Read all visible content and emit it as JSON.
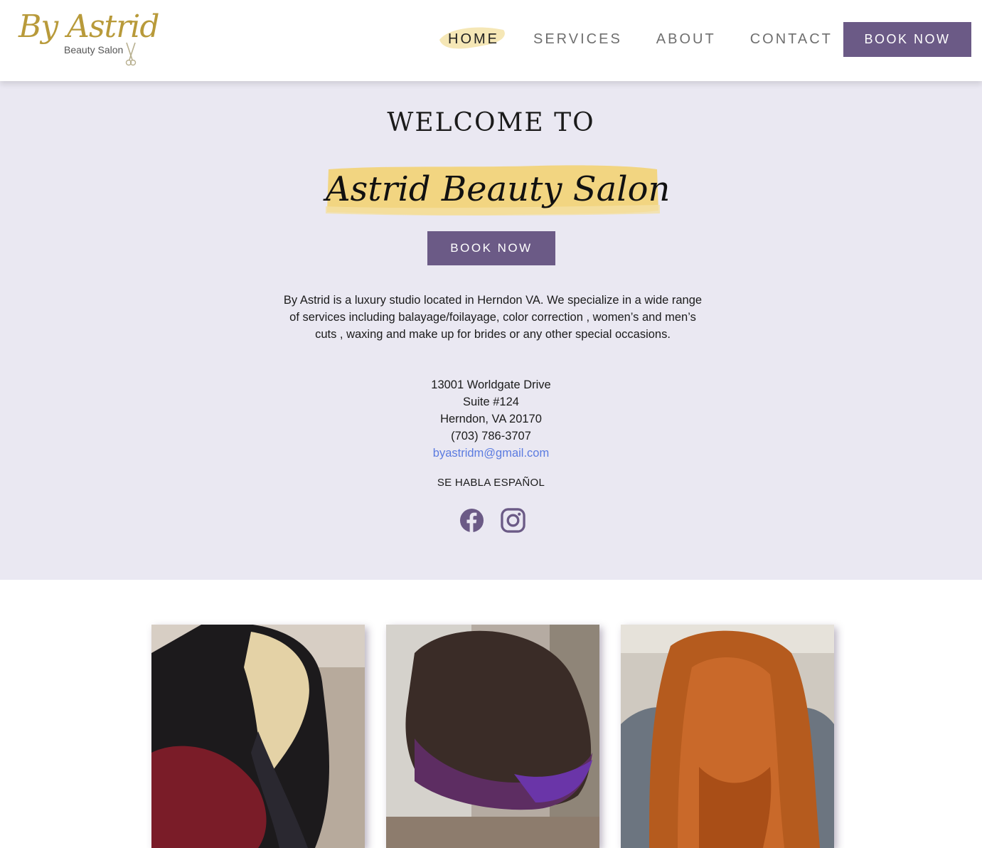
{
  "header": {
    "logo": {
      "script_text": "By Astrid",
      "subtitle": "Beauty Salon",
      "icon": "scissors-icon"
    },
    "nav": [
      {
        "label": "HOME",
        "active": true
      },
      {
        "label": "SERVICES",
        "active": false
      },
      {
        "label": "ABOUT",
        "active": false
      },
      {
        "label": "CONTACT",
        "active": false
      }
    ],
    "book_button": "BOOK NOW"
  },
  "hero": {
    "welcome": "WELCOME TO",
    "salon_name": "Astrid Beauty Salon",
    "book_button": "BOOK NOW",
    "description": "By Astrid is a luxury studio located in Herndon VA. We specialize in a wide range of services including balayage/foilayage, color correction , women’s and men’s cuts , waxing and make up for brides or any other special occasions.",
    "address_line1": "13001 Worldgate Drive",
    "address_line2": "Suite #124",
    "address_line3": "Herndon, VA 20170",
    "phone": "(703) 786-3707",
    "email": "byastridm@gmail.com",
    "language_note": "SE HABLA ESPAÑOL",
    "social": [
      {
        "icon": "facebook-icon"
      },
      {
        "icon": "instagram-icon"
      }
    ]
  },
  "gallery": [
    {
      "subject": "black-and-blonde-balayage-photo"
    },
    {
      "subject": "purple-ombre-bob-photo"
    },
    {
      "subject": "copper-long-waves-photo"
    }
  ],
  "colors": {
    "brand_purple": "#6b5a86",
    "brand_gold": "#b89a3a",
    "highlight_yellow": "#f2d47a",
    "hero_bg": "#eae8f2",
    "link_blue": "#5b7be0"
  }
}
